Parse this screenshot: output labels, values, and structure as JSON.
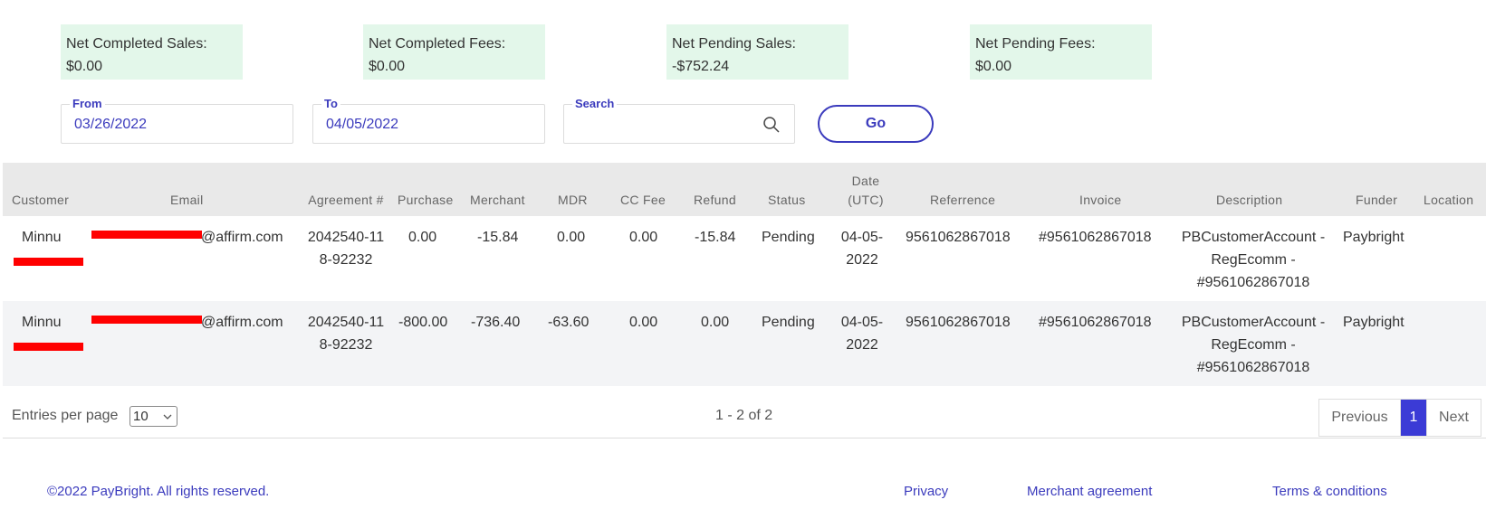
{
  "summary": [
    {
      "label": "Net Completed Sales:",
      "value": "$0.00"
    },
    {
      "label": "Net Completed Fees:",
      "value": "$0.00"
    },
    {
      "label": "Net Pending Sales:",
      "value": "-$752.24"
    },
    {
      "label": "Net Pending Fees:",
      "value": "$0.00"
    }
  ],
  "filters": {
    "from_label": "From",
    "from_value": "03/26/2022",
    "to_label": "To",
    "to_value": "04/05/2022",
    "search_label": "Search",
    "search_value": "",
    "go_label": "Go"
  },
  "table": {
    "headers": {
      "customer": "Customer",
      "email": "Email",
      "agreement": "Agreement #",
      "purchase": "Purchase",
      "merchant": "Merchant",
      "mdr": "MDR",
      "cc_fee": "CC Fee",
      "refund": "Refund",
      "status": "Status",
      "date": "Date (UTC)",
      "reference": "Referrence",
      "invoice": "Invoice",
      "description": "Description",
      "funder": "Funder",
      "location": "Location"
    },
    "rows": [
      {
        "customer": "Minnu",
        "email": "@affirm.com",
        "agreement": "2042540-118-92232",
        "purchase": "0.00",
        "merchant": "-15.84",
        "mdr": "0.00",
        "cc_fee": "0.00",
        "refund": "-15.84",
        "status": "Pending",
        "date": "04-05-2022",
        "reference": "9561062867018",
        "invoice": "#9561062867018",
        "description": "PBCustomerAccount - RegEcomm - #9561062867018",
        "funder": "Paybright",
        "location": ""
      },
      {
        "customer": "Minnu",
        "email": "@affirm.com",
        "agreement": "2042540-118-92232",
        "purchase": "-800.00",
        "merchant": "-736.40",
        "mdr": "-63.60",
        "cc_fee": "0.00",
        "refund": "0.00",
        "status": "Pending",
        "date": "04-05-2022",
        "reference": "9561062867018",
        "invoice": "#9561062867018",
        "description": "PBCustomerAccount - RegEcomm - #9561062867018",
        "funder": "Paybright",
        "location": ""
      }
    ]
  },
  "pagination": {
    "entries_label": "Entries per page",
    "entries_value": "10",
    "range_text": "1 - 2 of 2",
    "previous_label": "Previous",
    "current_page": "1",
    "next_label": "Next"
  },
  "footer": {
    "copyright": "©2022 PayBright. All rights reserved.",
    "privacy": "Privacy",
    "merchant_agreement": "Merchant agreement",
    "terms": "Terms & conditions"
  },
  "colors": {
    "accent": "#3b3bbd",
    "summary_bg": "#e3f7ea",
    "header_bg": "#e9e9e9",
    "alt_row_bg": "#f3f4f6",
    "redaction": "#ff0000"
  }
}
